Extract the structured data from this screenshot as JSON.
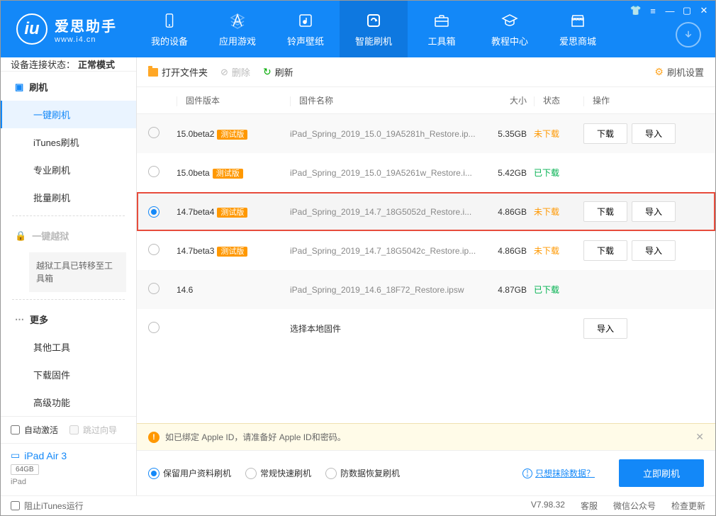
{
  "logo": {
    "main": "爱思助手",
    "sub": "www.i4.cn"
  },
  "nav": [
    {
      "label": "我的设备",
      "icon": "phone"
    },
    {
      "label": "应用游戏",
      "icon": "apps"
    },
    {
      "label": "铃声壁纸",
      "icon": "music"
    },
    {
      "label": "智能刷机",
      "icon": "refresh",
      "active": true
    },
    {
      "label": "工具箱",
      "icon": "toolbox"
    },
    {
      "label": "教程中心",
      "icon": "graduation"
    },
    {
      "label": "爱思商城",
      "icon": "store"
    }
  ],
  "status": {
    "label": "设备连接状态：",
    "value": "正常模式"
  },
  "sidebar": {
    "flash_head": "刷机",
    "items": [
      "一键刷机",
      "iTunes刷机",
      "专业刷机",
      "批量刷机"
    ],
    "jailbreak": "一键越狱",
    "jailbreak_note": "越狱工具已转移至工具箱",
    "more_head": "更多",
    "more_items": [
      "其他工具",
      "下载固件",
      "高级功能"
    ],
    "auto_activate": "自动激活",
    "skip_guide": "跳过向导",
    "device_name": "iPad Air 3",
    "device_storage": "64GB",
    "device_model": "iPad"
  },
  "toolbar": {
    "open_folder": "打开文件夹",
    "delete": "删除",
    "refresh": "刷新",
    "settings": "刷机设置"
  },
  "table": {
    "headers": {
      "version": "固件版本",
      "name": "固件名称",
      "size": "大小",
      "status": "状态",
      "action": "操作"
    },
    "rows": [
      {
        "version": "15.0beta2",
        "badge": "测试版",
        "name": "iPad_Spring_2019_15.0_19A5281h_Restore.ip...",
        "size": "5.35GB",
        "status_key": "nd",
        "status": "未下载",
        "actions": [
          "下载",
          "导入"
        ],
        "selected": false
      },
      {
        "version": "15.0beta",
        "badge": "测试版",
        "name": "iPad_Spring_2019_15.0_19A5261w_Restore.i...",
        "size": "5.42GB",
        "status_key": "dd",
        "status": "已下载",
        "actions": [],
        "selected": false
      },
      {
        "version": "14.7beta4",
        "badge": "测试版",
        "name": "iPad_Spring_2019_14.7_18G5052d_Restore.i...",
        "size": "4.86GB",
        "status_key": "nd",
        "status": "未下载",
        "actions": [
          "下载",
          "导入"
        ],
        "selected": true,
        "highlighted": true
      },
      {
        "version": "14.7beta3",
        "badge": "测试版",
        "name": "iPad_Spring_2019_14.7_18G5042c_Restore.ip...",
        "size": "4.86GB",
        "status_key": "nd",
        "status": "未下载",
        "actions": [
          "下载",
          "导入"
        ],
        "selected": false
      },
      {
        "version": "14.6",
        "badge": "",
        "name": "iPad_Spring_2019_14.6_18F72_Restore.ipsw",
        "size": "4.87GB",
        "status_key": "dd",
        "status": "已下载",
        "actions": [],
        "selected": false
      },
      {
        "version": "",
        "badge": "",
        "name_alt": "选择本地固件",
        "size": "",
        "status": "",
        "actions": [
          "导入"
        ],
        "selected": false
      }
    ]
  },
  "alert": "如已绑定 Apple ID，请准备好 Apple ID和密码。",
  "bottom": {
    "opts": [
      "保留用户资料刷机",
      "常规快速刷机",
      "防数据恢复刷机"
    ],
    "link": "只想抹除数据？",
    "flash_btn": "立即刷机"
  },
  "footer": {
    "block_itunes": "阻止iTunes运行",
    "version": "V7.98.32",
    "links": [
      "客服",
      "微信公众号",
      "检查更新"
    ]
  }
}
